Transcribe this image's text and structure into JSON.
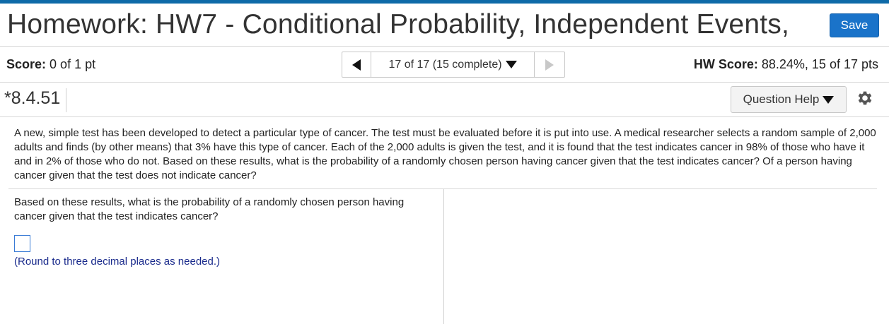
{
  "header": {
    "title": "Homework: HW7 - Conditional Probability, Independent Events,",
    "save_label": "Save"
  },
  "score_bar": {
    "score_label": "Score:",
    "score_value": "0 of 1 pt",
    "nav_label": "17 of 17 (15 complete)",
    "hw_score_label": "HW Score:",
    "hw_score_value": "88.24%, 15 of 17 pts"
  },
  "question_bar": {
    "number": "*8.4.51",
    "help_label": "Question Help"
  },
  "problem": {
    "text": "A new, simple test has been developed to detect a particular type of cancer. The test must be evaluated before it is put into use. A medical researcher selects a random sample of 2,000 adults and finds (by other means) that 3% have this type of cancer. Each of the 2,000 adults is given the test, and it is found that the test indicates cancer in 98% of those who have it and in 2% of those who do not. Based on these results, what is the probability of a randomly chosen person having cancer given that the test indicates cancer? Of a person having cancer given that the test does not indicate cancer?",
    "subquestion": "Based on these results, what is the probability of a randomly chosen person having cancer given that the test indicates cancer?",
    "answer_value": "",
    "hint": "(Round to three decimal places as needed.)"
  },
  "icons": {
    "prev": "triangle-left-icon",
    "next": "triangle-right-icon",
    "dropdown": "triangle-down-icon",
    "settings": "gear-icon"
  },
  "colors": {
    "accent": "#0e6aa8",
    "save_button": "#1a73c9",
    "hint_text": "#1a2b8c"
  }
}
